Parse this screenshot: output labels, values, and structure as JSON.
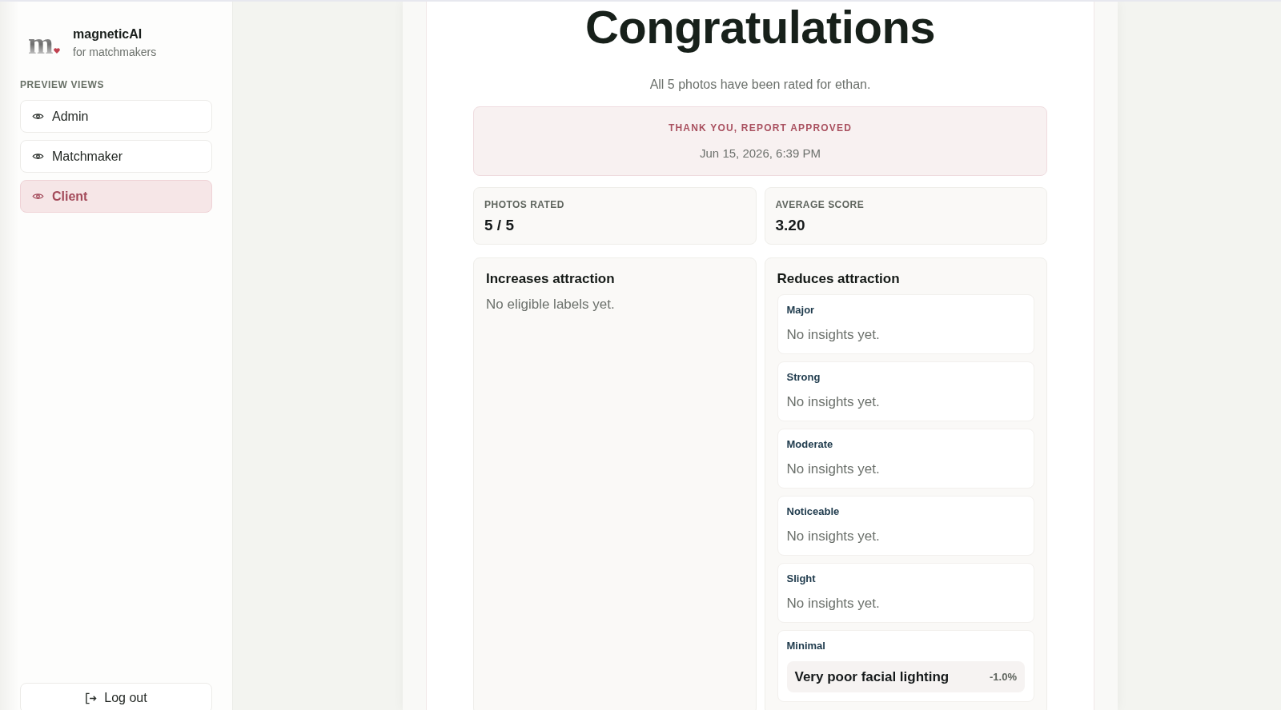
{
  "sidebar": {
    "brand": {
      "logo_letter": "m",
      "name": "magneticAI",
      "tagline": "for matchmakers"
    },
    "section_label": "PREVIEW VIEWS",
    "items": [
      {
        "label": "Admin",
        "selected": false
      },
      {
        "label": "Matchmaker",
        "selected": false
      },
      {
        "label": "Client",
        "selected": true
      }
    ],
    "logout": {
      "label": "Log out"
    }
  },
  "report": {
    "title": "Congratulations",
    "subtitle": "All 5 photos have been rated for ethan.",
    "status": {
      "label": "THANK YOU, REPORT APPROVED",
      "date": "Jun 15, 2026, 6:39 PM"
    },
    "stats": [
      {
        "label": "PHOTOS RATED",
        "value": "5 / 5"
      },
      {
        "label": "AVERAGE SCORE",
        "value": "3.20"
      }
    ],
    "increases": {
      "title": "Increases attraction",
      "empty_text": "No eligible labels yet."
    },
    "reduces": {
      "title": "Reduces attraction",
      "groups": [
        {
          "label": "Major",
          "empty_text": "No insights yet."
        },
        {
          "label": "Strong",
          "empty_text": "No insights yet."
        },
        {
          "label": "Moderate",
          "empty_text": "No insights yet."
        },
        {
          "label": "Noticeable",
          "empty_text": "No insights yet."
        },
        {
          "label": "Slight",
          "empty_text": "No insights yet."
        },
        {
          "label": "Minimal",
          "insights": [
            {
              "label": "Very poor facial lighting",
              "value": "-1.0%"
            }
          ]
        }
      ]
    }
  }
}
